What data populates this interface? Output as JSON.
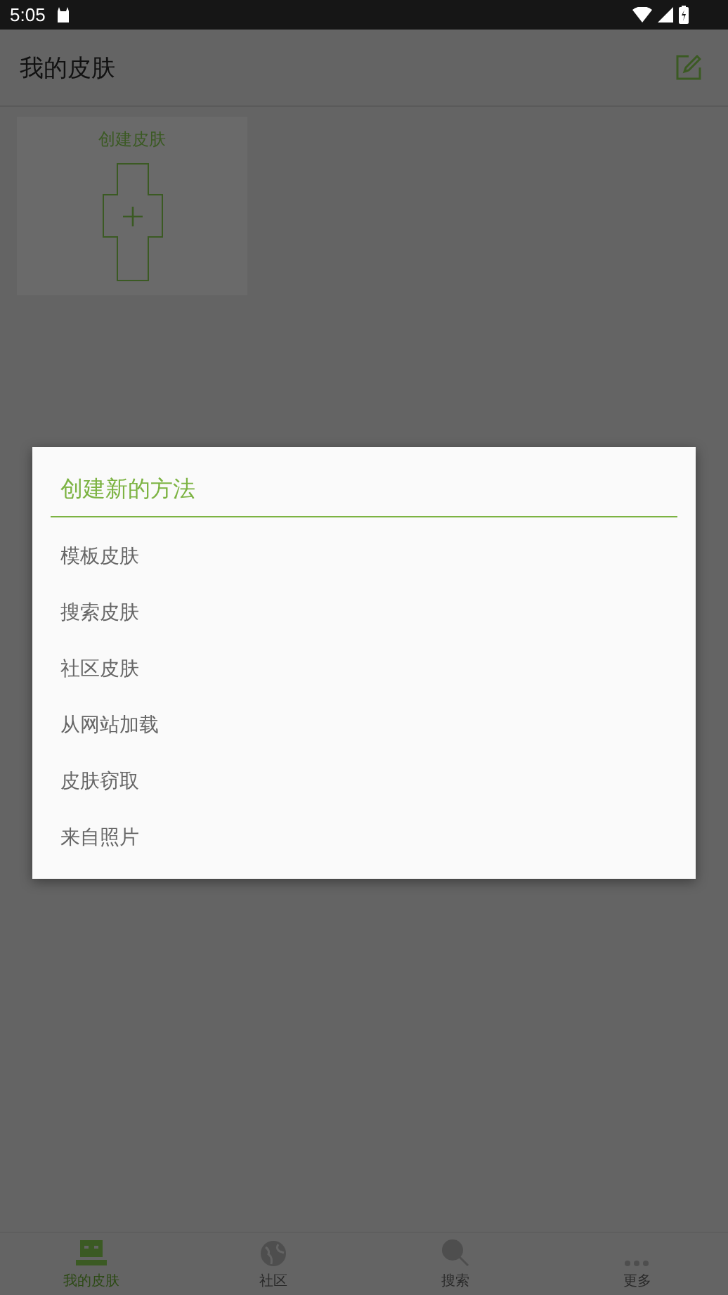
{
  "status_bar": {
    "time": "5:05"
  },
  "app_bar": {
    "title": "我的皮肤"
  },
  "create_card": {
    "label": "创建皮肤"
  },
  "dialog": {
    "title": "创建新的方法",
    "options": [
      {
        "label": "模板皮肤"
      },
      {
        "label": "搜索皮肤"
      },
      {
        "label": "社区皮肤"
      },
      {
        "label": "从网站加载"
      },
      {
        "label": "皮肤窃取"
      },
      {
        "label": "来自照片"
      }
    ]
  },
  "bottom_nav": [
    {
      "label": "我的皮肤",
      "selected": true
    },
    {
      "label": "社区",
      "selected": false
    },
    {
      "label": "搜索",
      "selected": false
    },
    {
      "label": "更多",
      "selected": false
    }
  ]
}
